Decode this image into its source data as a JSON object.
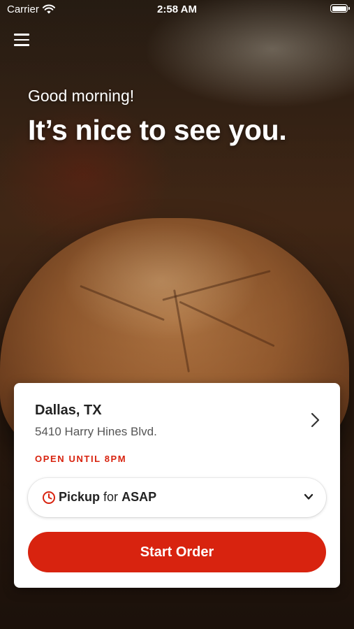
{
  "status_bar": {
    "carrier": "Carrier",
    "time": "2:58 AM",
    "wifi_icon": "wifi-icon",
    "battery_icon": "battery-icon"
  },
  "header": {
    "menu_icon": "hamburger-menu-icon",
    "greeting": "Good morning!",
    "headline": "It’s nice to see you."
  },
  "location_card": {
    "city": "Dallas, TX",
    "address": "5410 Harry Hines Blvd.",
    "hours": "OPEN UNTIL 8PM",
    "chevron_icon": "chevron-right-icon",
    "order_mode": {
      "icon": "clock-icon",
      "mode": "Pickup",
      "connector": "for",
      "time": "ASAP",
      "dropdown_icon": "chevron-down-icon"
    },
    "start_order_label": "Start Order"
  },
  "colors": {
    "accent": "#d8230f",
    "card_background": "#ffffff",
    "text_primary": "#222222",
    "text_secondary": "#555555"
  }
}
